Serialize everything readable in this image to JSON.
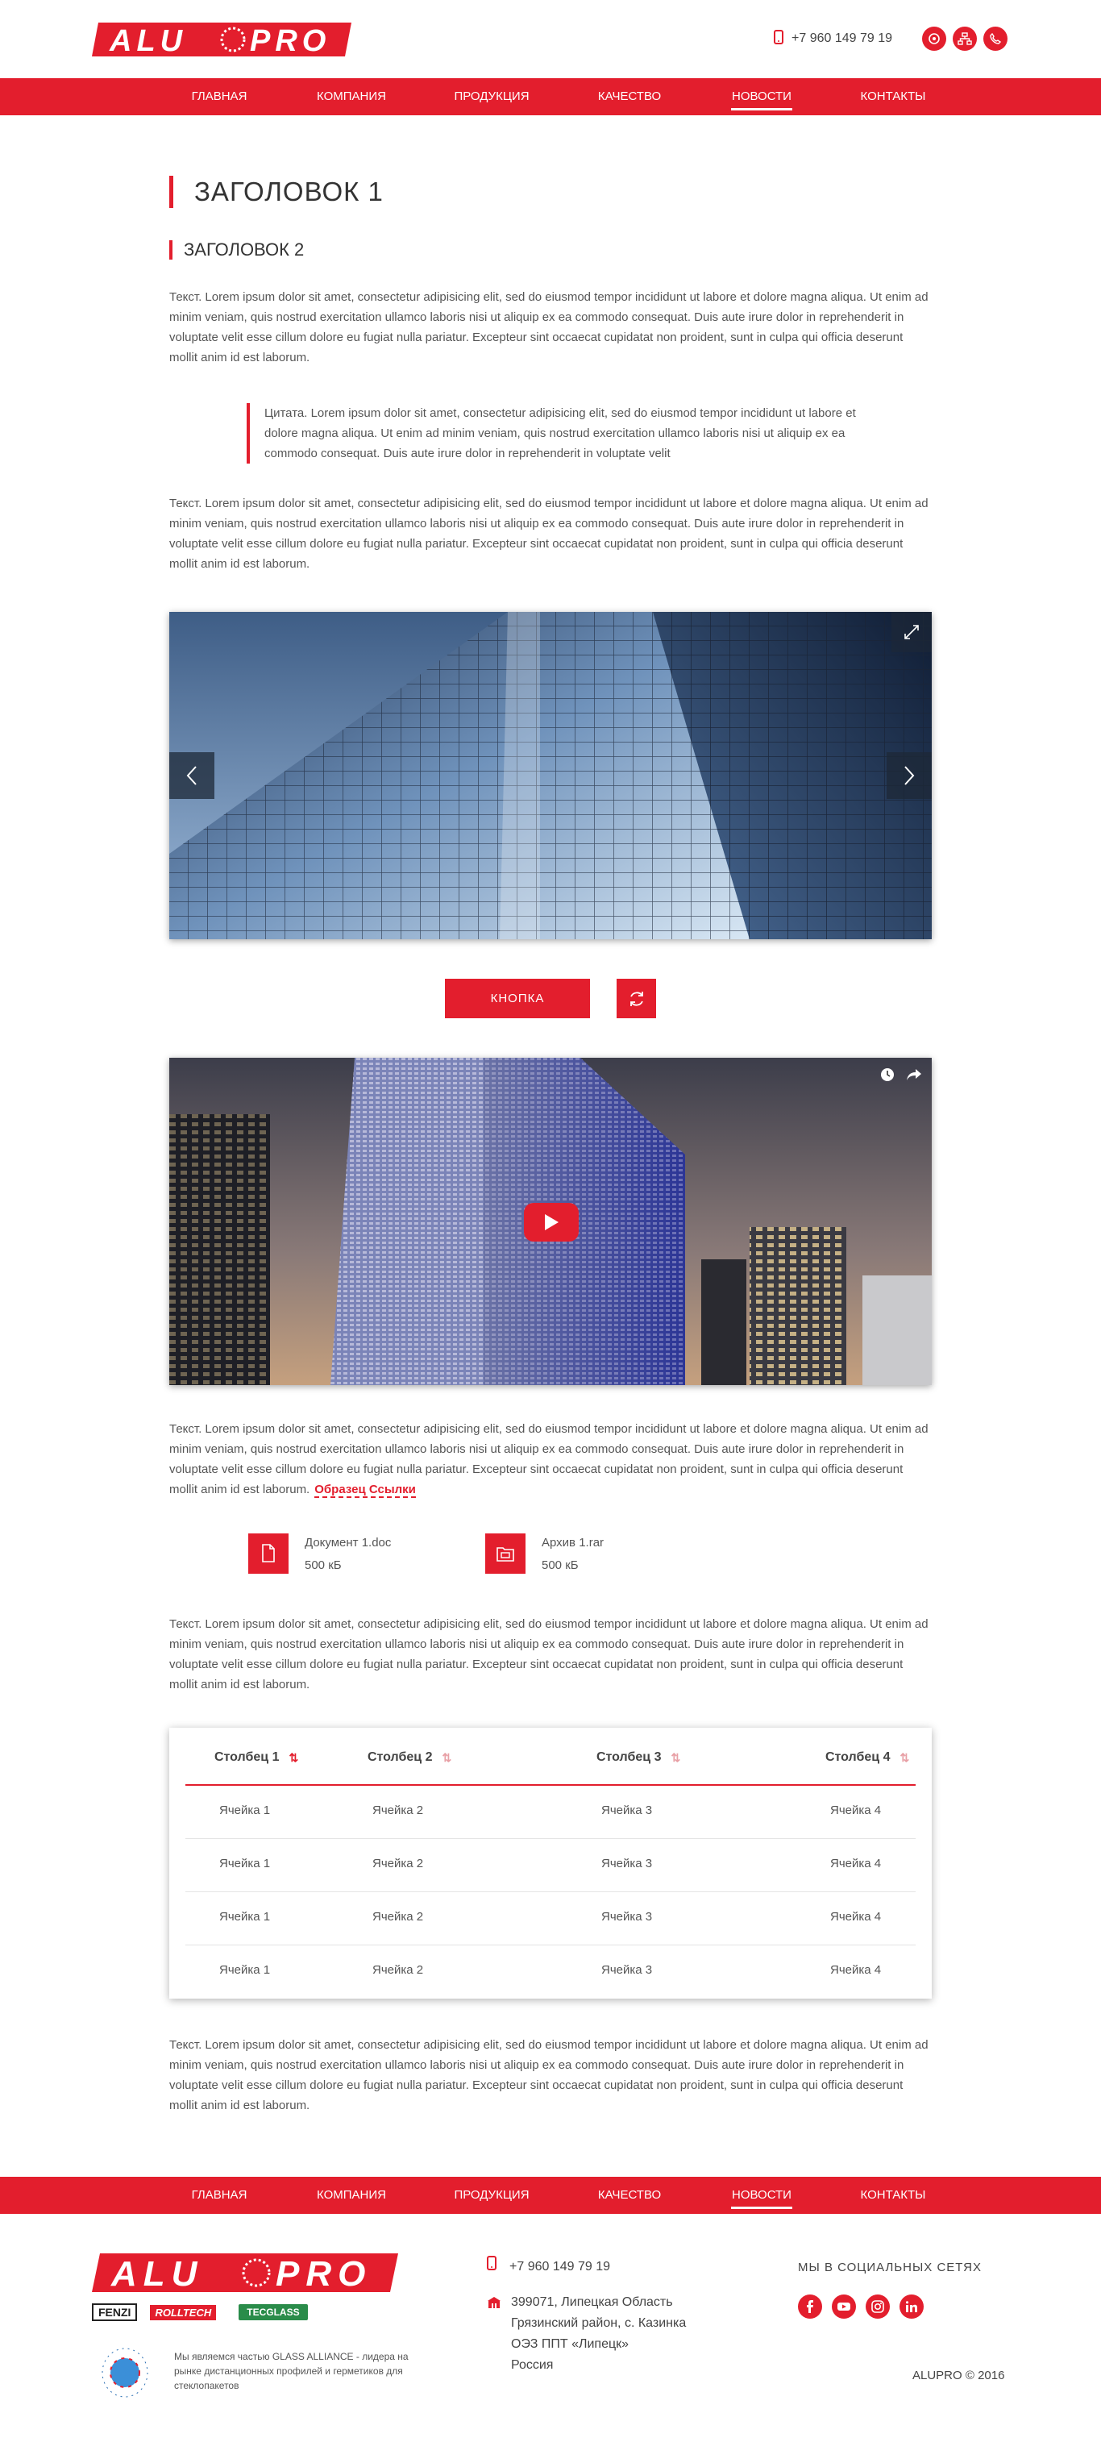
{
  "brand": {
    "logo_text": "ALUPRO",
    "accent": "#e31e2d"
  },
  "header": {
    "phone": "+7 960 149 79 19"
  },
  "nav": {
    "items": [
      {
        "label": "ГЛАВНАЯ",
        "active": false
      },
      {
        "label": "КОМПАНИЯ",
        "active": false
      },
      {
        "label": "ПРОДУКЦИЯ",
        "active": false
      },
      {
        "label": "КАЧЕСТВО",
        "active": false
      },
      {
        "label": "НОВОСТИ",
        "active": true
      },
      {
        "label": "КОНТАКТЫ",
        "active": false
      }
    ]
  },
  "content": {
    "h1": "ЗАГОЛОВОК 1",
    "h2": "ЗАГОЛОВОК 2",
    "paragraph": "Текст. Lorem ipsum dolor sit amet, consectetur adipisicing elit, sed do eiusmod tempor incididunt ut labore et dolore magna aliqua. Ut enim ad minim veniam, quis nostrud exercitation ullamco laboris nisi ut aliquip ex ea commodo consequat. Duis aute irure dolor in reprehenderit in voluptate velit esse cillum dolore eu fugiat nulla pariatur. Excepteur sint occaecat cupidatat non proident, sunt in culpa qui officia deserunt mollit anim id est laborum.",
    "quote": "Цитата. Lorem ipsum dolor sit amet, consectetur adipisicing elit, sed do eiusmod tempor incididunt ut labore et dolore magna aliqua. Ut enim ad minim veniam, quis nostrud exercitation ullamco laboris nisi ut aliquip ex ea commodo consequat. Duis aute irure dolor in reprehenderit in voluptate velit",
    "button_label": "КНОПКА",
    "link_label": "Образец Ссылки",
    "files": [
      {
        "name": "Документ 1.doc",
        "size": "500 кБ",
        "icon": "document-icon"
      },
      {
        "name": "Архив 1.rar",
        "size": "500 кБ",
        "icon": "archive-icon"
      }
    ],
    "table": {
      "headers": [
        "Столбец 1",
        "Столбец 2",
        "Столбец 3",
        "Столбец 4"
      ],
      "rows": [
        [
          "Ячейка 1",
          "Ячейка 2",
          "Ячейка 3",
          "Ячейка 4"
        ],
        [
          "Ячейка 1",
          "Ячейка 2",
          "Ячейка 3",
          "Ячейка 4"
        ],
        [
          "Ячейка 1",
          "Ячейка 2",
          "Ячейка 3",
          "Ячейка 4"
        ],
        [
          "Ячейка 1",
          "Ячейка 2",
          "Ячейка 3",
          "Ячейка 4"
        ]
      ]
    }
  },
  "footer": {
    "phone": "+7 960 149 79 19",
    "address": [
      "399071, Липецкая Область",
      "Грязинский район, с. Казинка",
      "ОЭЗ ППТ «Липецк»",
      "Россия"
    ],
    "social_title": "МЫ В СОЦИАЛЬНЫХ СЕТЯХ",
    "social_icons": [
      "facebook-icon",
      "youtube-icon",
      "instagram-icon",
      "linkedin-icon"
    ],
    "partners": [
      "FENZI",
      "ROLLTECH",
      "TECGLASS"
    ],
    "ga_text": "Мы являемся частью GLASS ALLIANCE - лидера на рынке дистанционных профилей и герметиков для стеклопакетов",
    "copyright": "ALUPRO © 2016"
  }
}
